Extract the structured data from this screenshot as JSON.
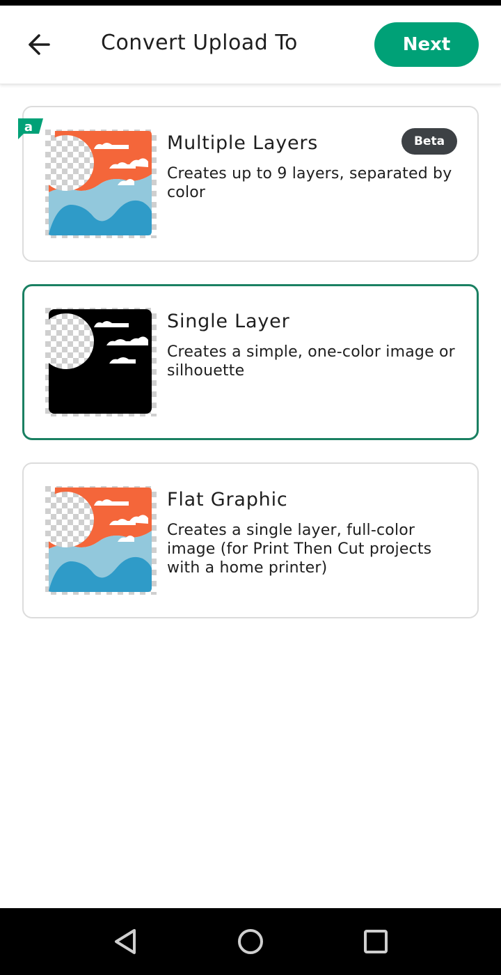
{
  "header": {
    "title": "Convert Upload To",
    "back_icon": "arrow-left-icon",
    "next_label": "Next"
  },
  "options": [
    {
      "title": "Multiple Layers",
      "description": "Creates up to 9 layers, separated by color",
      "badge": "Beta",
      "selected": false,
      "preview": "color-preview"
    },
    {
      "title": "Single Layer",
      "description": "Creates a simple, one-color image or silhouette",
      "selected": true,
      "preview": "silhouette-preview"
    },
    {
      "title": "Flat Graphic",
      "description": "Creates a single layer, full-color image (for Print Then Cut projects with a home printer)",
      "selected": false,
      "preview": "color-preview"
    }
  ],
  "colors": {
    "accent": "#00a177",
    "selected_border": "#1a8062",
    "badge_bg": "#3d4145",
    "preview_orange": "#f4663a",
    "preview_light_blue": "#92c8dc",
    "preview_blue": "#2f9bc8"
  },
  "system_nav": {
    "back_icon": "triangle-back-icon",
    "home_icon": "circle-home-icon",
    "recents_icon": "square-recents-icon"
  }
}
